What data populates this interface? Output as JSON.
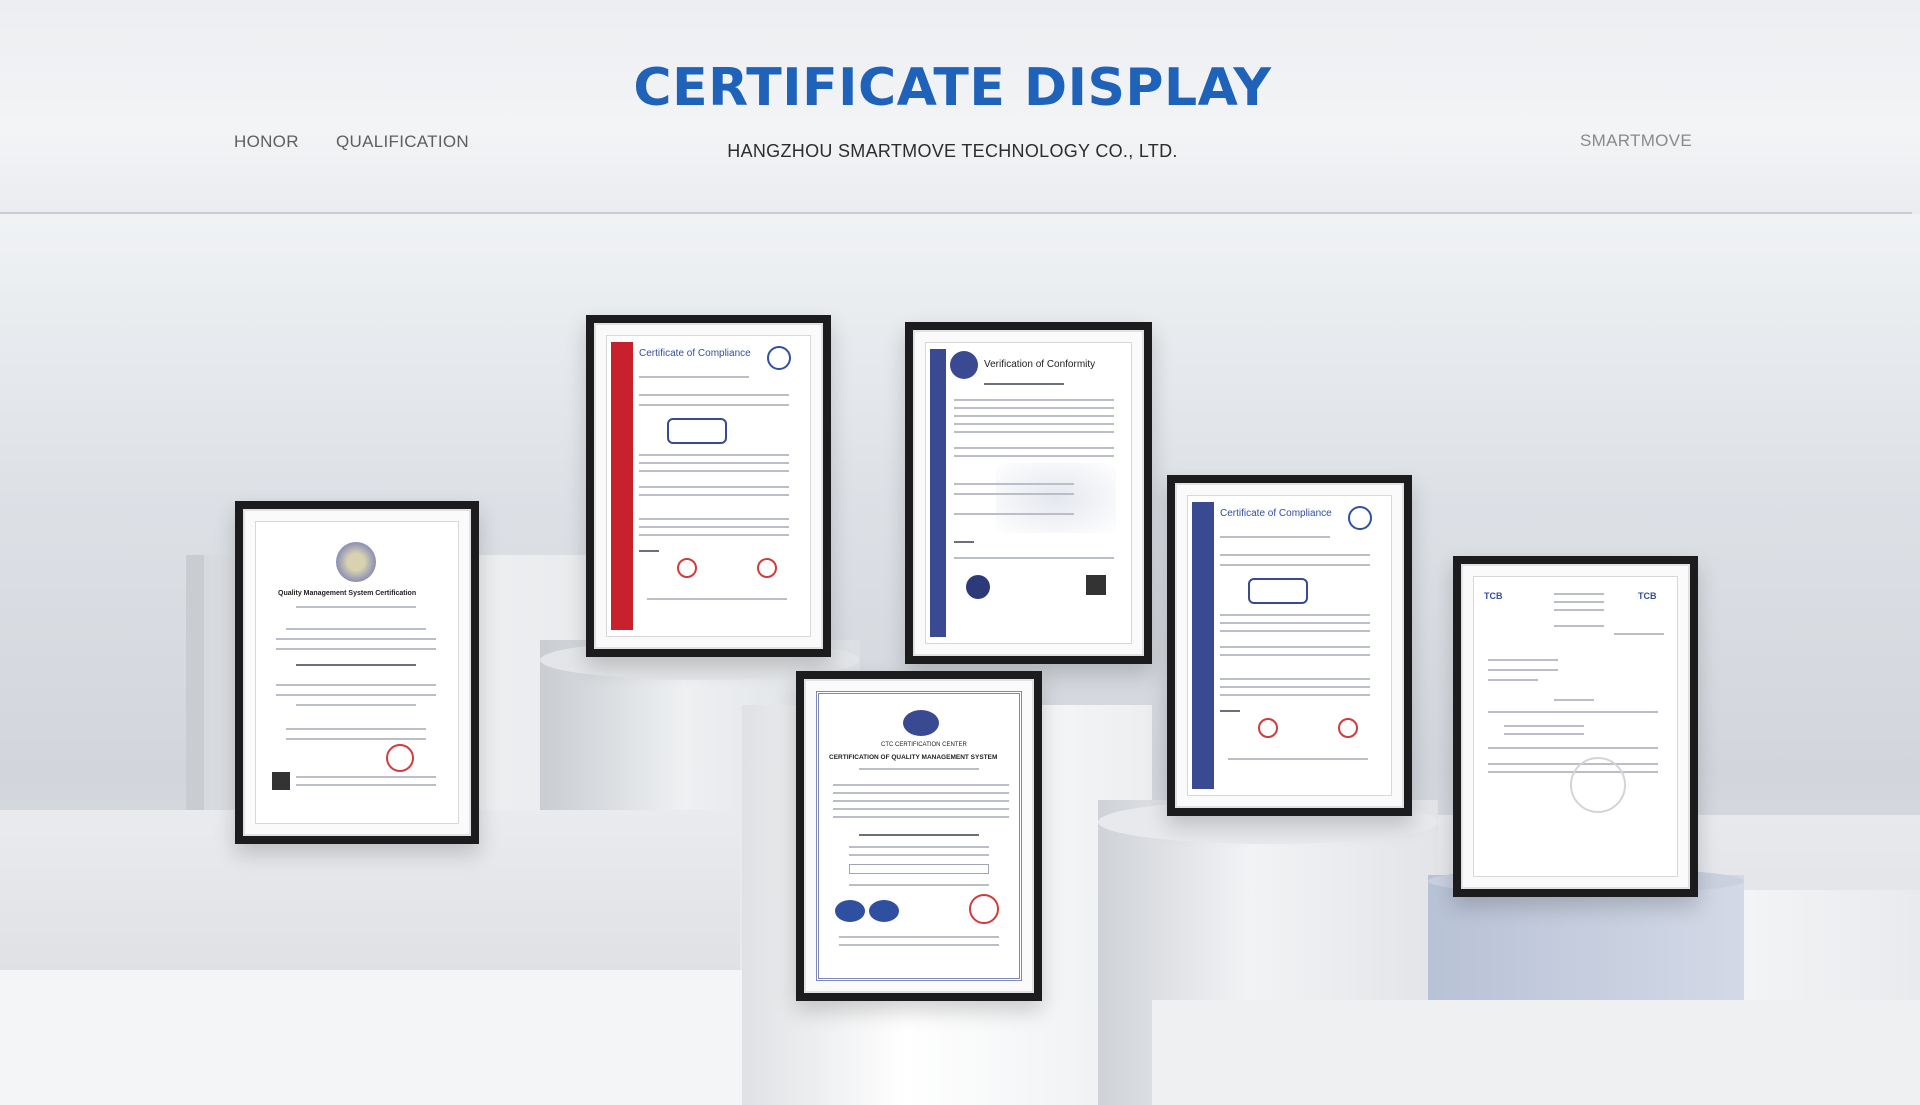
{
  "header": {
    "title": "CERTIFICATE DISPLAY",
    "subtitle": "HANGZHOU SMARTMOVE TECHNOLOGY CO., LTD.",
    "nav": [
      "HONOR",
      "QUALIFICATION"
    ],
    "brand": "SMARTMOVE"
  },
  "certificates": [
    {
      "heading": "Quality Management System Certification"
    },
    {
      "heading": "Certificate of Compliance"
    },
    {
      "heading": "Verification of Conformity"
    },
    {
      "heading": "CERTIFICATION OF QUALITY MANAGEMENT SYSTEM"
    },
    {
      "heading": "Certificate of Compliance"
    },
    {
      "heading": "TCB"
    }
  ],
  "colors": {
    "title": "#1f62b9",
    "accent_red": "#c8202c",
    "accent_blue": "#3a4a92"
  }
}
